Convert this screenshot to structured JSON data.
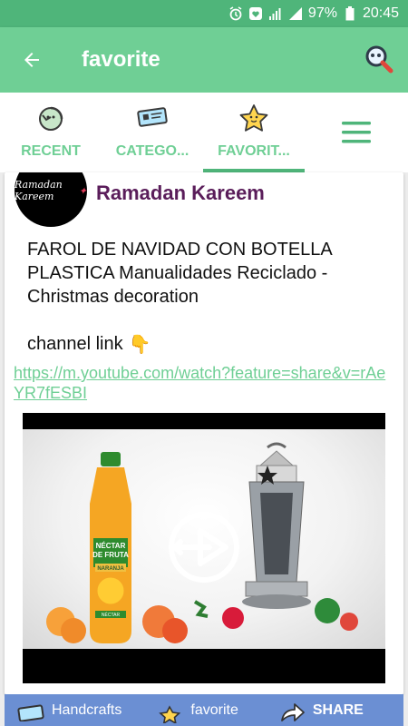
{
  "status_bar": {
    "battery": "97%",
    "time": "20:45"
  },
  "app_bar": {
    "title": "favorite"
  },
  "tabs": [
    {
      "label": "RECENT",
      "icon": "refresh-icon"
    },
    {
      "label": "CATEGO...",
      "icon": "ticket-icon"
    },
    {
      "label": "FAVORIT...",
      "icon": "star-face-icon"
    }
  ],
  "post": {
    "avatar_text": "Ramadan Kareem",
    "channel_name": "Ramadan Kareem",
    "text": "FAROL DE NAVIDAD CON BOTELLA PLASTICA Manualidades Reciclado - Christmas decoration",
    "channel_line": "channel link",
    "channel_emoji": "👇",
    "link": "https://m.youtube.com/watch?feature=share&v=rAeYR7fESBI"
  },
  "video": {
    "bottle_brand_1": "NÉCTAR",
    "bottle_brand_2": "DE FRUTA",
    "bottle_flavor": "NARANJA",
    "bottle_bottom": "NÉCTAR"
  },
  "bottom_bar": {
    "category": "Handcrafts",
    "favorite": "favorite",
    "share": "SHARE"
  },
  "colors": {
    "primary": "#6fcf95",
    "primary_dark": "#4fb57a",
    "bottom_bar": "#6b8fd3",
    "channel_name": "#5a1d5a"
  }
}
